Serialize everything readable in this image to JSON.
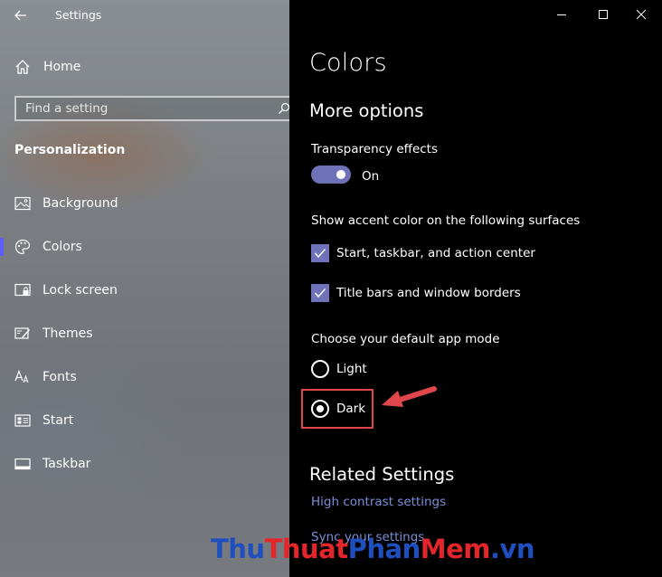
{
  "window": {
    "title": "Settings"
  },
  "sidebar": {
    "home_label": "Home",
    "search_placeholder": "Find a setting",
    "section_heading": "Personalization",
    "items": [
      {
        "label": "Background",
        "icon": "picture-icon"
      },
      {
        "label": "Colors",
        "icon": "palette-icon",
        "selected": true
      },
      {
        "label": "Lock screen",
        "icon": "lock-screen-icon"
      },
      {
        "label": "Themes",
        "icon": "themes-icon"
      },
      {
        "label": "Fonts",
        "icon": "fonts-icon"
      },
      {
        "label": "Start",
        "icon": "start-icon"
      },
      {
        "label": "Taskbar",
        "icon": "taskbar-icon"
      }
    ]
  },
  "main": {
    "page_title": "Colors",
    "more_options_heading": "More options",
    "transparency": {
      "label": "Transparency effects",
      "state_label": "On",
      "enabled": true
    },
    "accent_surfaces": {
      "label": "Show accent color on the following surfaces",
      "options": [
        {
          "label": "Start, taskbar, and action center",
          "checked": true
        },
        {
          "label": "Title bars and window borders",
          "checked": true
        }
      ]
    },
    "app_mode": {
      "label": "Choose your default app mode",
      "options": [
        {
          "label": "Light",
          "selected": false
        },
        {
          "label": "Dark",
          "selected": true
        }
      ]
    },
    "related_heading": "Related Settings",
    "related_links": [
      "High contrast settings",
      "Sync your settings"
    ]
  },
  "watermark": {
    "part1": "Thu",
    "part2": "Thuat",
    "part3": "Phan",
    "part4": "Mem",
    "part5": ".vn"
  },
  "colors": {
    "accent": "#6f72b8",
    "selection_bar": "#5e5cff",
    "highlight_box": "#e0474c",
    "link": "#7a8fd6"
  }
}
